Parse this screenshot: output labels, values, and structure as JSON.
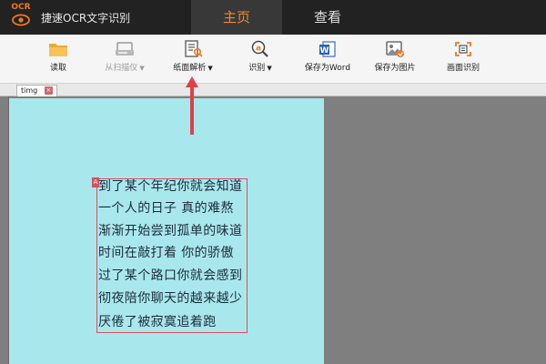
{
  "app": {
    "logo_text": "OCR",
    "title": "捷速OCR文字识别",
    "accent_color": "#f08a30"
  },
  "tabs": [
    {
      "label": "主页",
      "active": true
    },
    {
      "label": "查看",
      "active": false
    }
  ],
  "toolbar": {
    "read": {
      "label": "读取",
      "icon": "folder-icon"
    },
    "scan": {
      "label": "从扫描仪",
      "icon": "scanner-icon",
      "disabled": true
    },
    "paper_parse": {
      "label": "纸面解析",
      "icon": "document-search-icon"
    },
    "recognize": {
      "label": "识别",
      "icon": "recognize-icon"
    },
    "save_word": {
      "label": "保存为Word",
      "icon": "word-icon"
    },
    "save_image": {
      "label": "保存为图片",
      "icon": "image-save-icon"
    },
    "region_recognize": {
      "label": "画面识别",
      "icon": "region-icon"
    }
  },
  "document_tab": {
    "label": "timg",
    "close": "×"
  },
  "ocr": {
    "tag": "A",
    "lines": [
      "到了某个年纪你就会知道",
      "一个人的日子 真的难熬",
      "渐渐开始尝到孤单的味道",
      "时间在敲打着 你的骄傲",
      "过了某个路口你就会感到",
      "彻夜陪你聊天的越来越少",
      "厌倦了被寂寞追着跑"
    ]
  }
}
